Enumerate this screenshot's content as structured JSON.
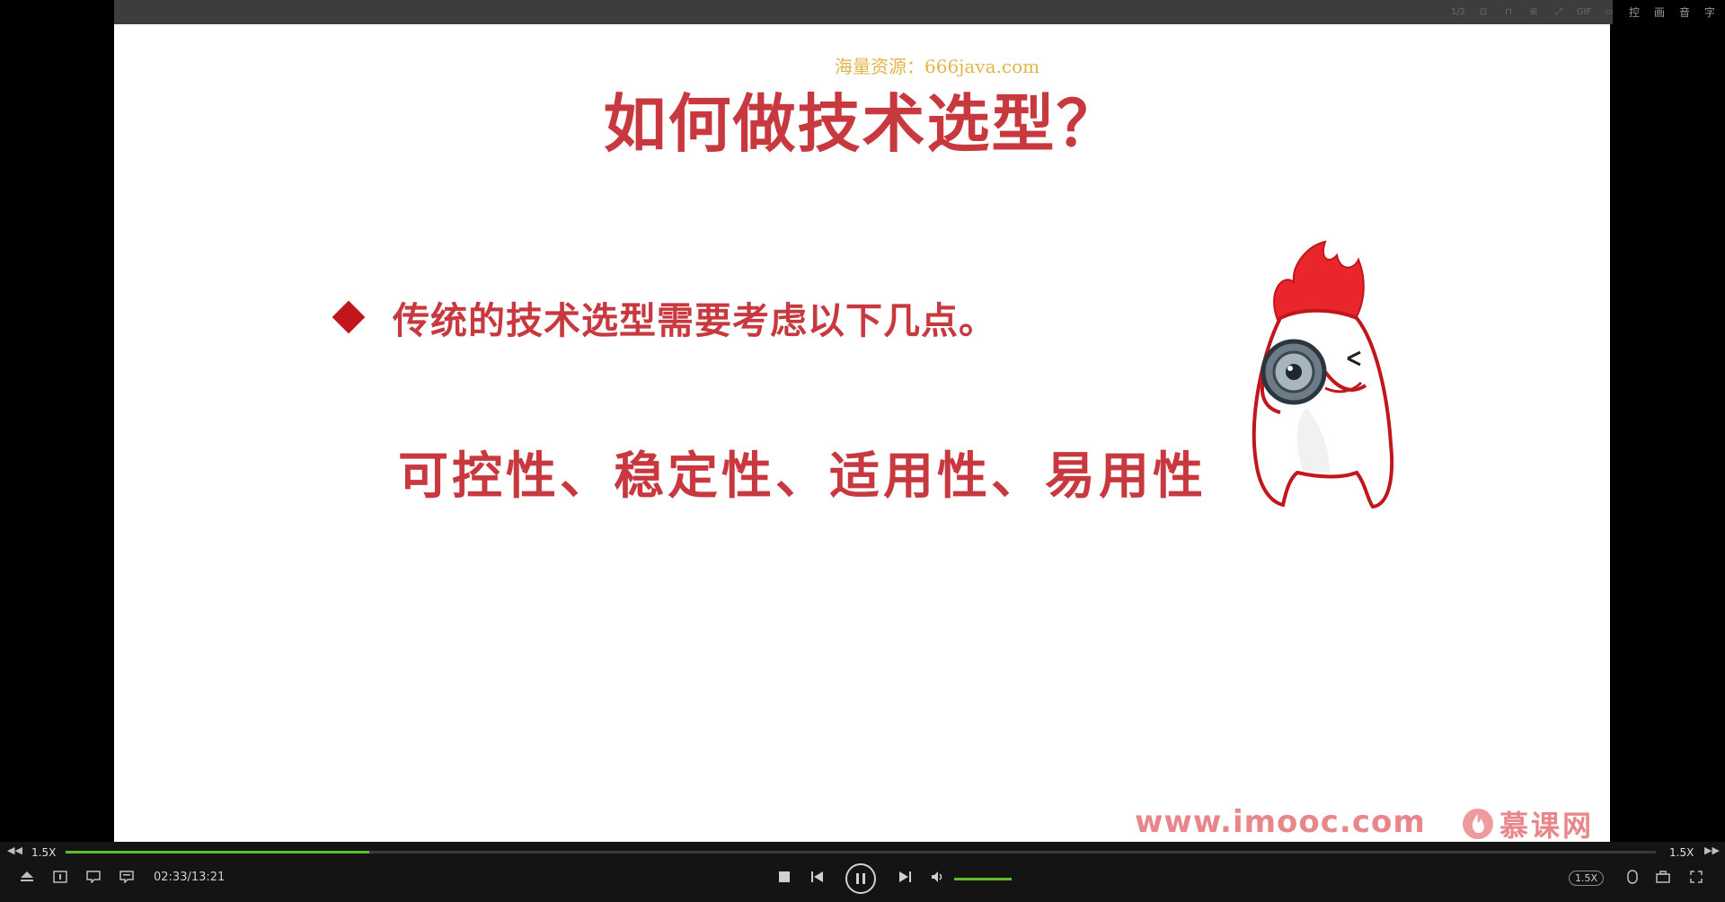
{
  "toolbar": {
    "page_counter": "1/2",
    "tools": [
      "控",
      "画",
      "音",
      "字"
    ],
    "icon_names": [
      "crop-icon",
      "frame-icon",
      "screenshot-icon",
      "gif-icon",
      "window-icon"
    ]
  },
  "slide": {
    "watermark": "海量资源：666java.com",
    "title": "如何做技术选型？",
    "bullet": "传统的技术选型需要考虑以下几点。",
    "criteria": "可控性、稳定性、适用性、易用性",
    "site_url": "www.imooc.com",
    "brand_name": "慕课网",
    "accent_color": "#c8393f"
  },
  "player": {
    "speed_left": "1.5X",
    "speed_right": "1.5X",
    "time": "02:33/13:21",
    "progress_fraction": 0.191,
    "volume_fraction": 1.0,
    "speed_badge": "1.5X",
    "progress_color": "#5fbf2a"
  }
}
